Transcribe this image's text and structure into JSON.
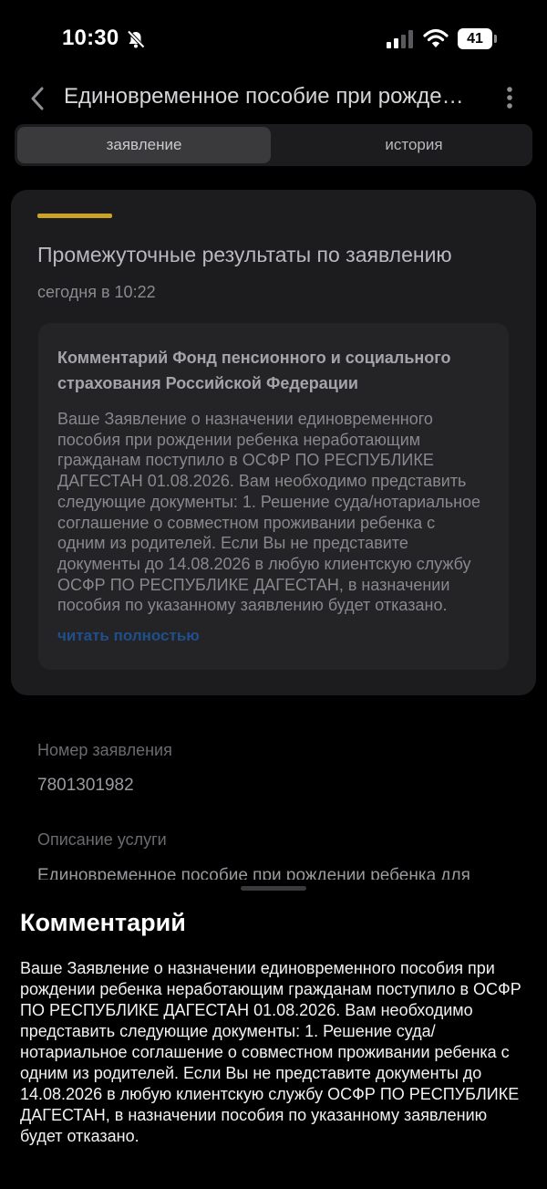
{
  "status_bar": {
    "time": "10:30",
    "battery": "41",
    "icons": [
      "bell-slash-icon",
      "signal-icon",
      "wifi-icon",
      "battery-icon"
    ]
  },
  "header": {
    "title": "Единовременное пособие при рождении ребенка",
    "back_icon": "chevron-left-icon",
    "more_icon": "more-vertical-icon"
  },
  "tabs": [
    {
      "label": "заявление",
      "active": true
    },
    {
      "label": "история",
      "active": false
    }
  ],
  "result_card": {
    "accent_color": "#c9a227",
    "title": "Промежуточные результаты по заявлению",
    "date": "сегодня в 10:22",
    "comment": {
      "heading": "Комментарий Фонд пенсионного и социального страхования Российской Федерации",
      "text": "Ваше Заявление о назначении единовременного пособия при рождении ребенка неработающим гражданам поступило в ОСФР ПО РЕСПУБЛИКЕ ДАГЕСТАН 01.08.2026. Вам необходимо представить следующие документы: 1. Решение суда/нотариальное соглашение о совместном проживании ребенка с одним из родителей. Если Вы не представите документы до 14.08.2026 в любую клиентскую службу ОСФР ПО РЕСПУБЛИКЕ ДАГЕСТАН, в назначении пособия по указанному заявлению будет отказано.",
      "read_more": "читать полностью",
      "link_color": "#1f4f8c"
    }
  },
  "application": {
    "number_label": "Номер заявления",
    "number": "7801301982",
    "description_label": "Описание услуги",
    "description": "Единовременное пособие при рождении ребенка для"
  },
  "sheet": {
    "title": "Комментарий",
    "text": "Ваше Заявление о назначении единовременного пособия при рождении ребенка неработающим гражданам поступило в ОСФР ПО РЕСПУБЛИКЕ ДАГЕСТАН 01.08.2026. Вам необходимо представить следующие документы: 1. Решение суда/нотариальное соглашение о совместном проживании ребенка с одним из родителей. Если Вы не представите документы до 14.08.2026 в любую клиентскую службу ОСФР ПО РЕСПУБЛИКЕ ДАГЕСТАН, в назначении пособия по указанному заявлению будет отказано."
  }
}
